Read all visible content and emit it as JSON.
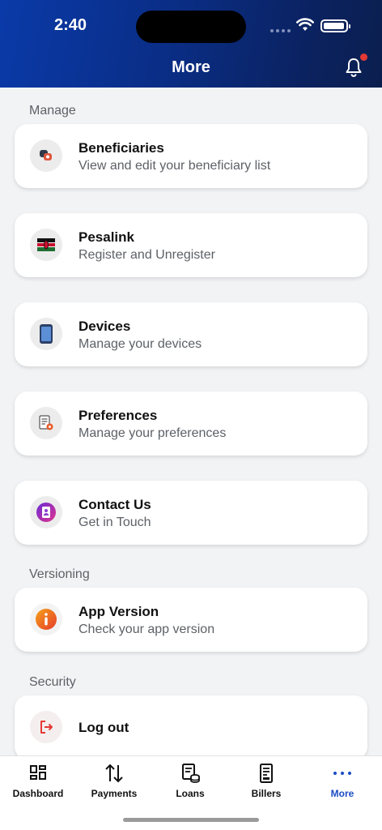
{
  "status_bar": {
    "time": "2:40"
  },
  "header": {
    "title": "More"
  },
  "sections": {
    "manage": "Manage",
    "versioning": "Versioning",
    "security": "Security"
  },
  "items": {
    "beneficiaries": {
      "title": "Beneficiaries",
      "subtitle": "View and edit your beneficiary list",
      "icon": "people-icon"
    },
    "pesalink": {
      "title": "Pesalink",
      "subtitle": "Register and Unregister",
      "icon": "kenya-flag-icon"
    },
    "devices": {
      "title": "Devices",
      "subtitle": "Manage your devices",
      "icon": "phone-icon"
    },
    "preferences": {
      "title": "Preferences",
      "subtitle": "Manage your preferences",
      "icon": "document-gear-icon"
    },
    "contact": {
      "title": "Contact Us",
      "subtitle": "Get in Touch",
      "icon": "contact-book-icon"
    },
    "app_version": {
      "title": "App Version",
      "subtitle": "Check your app version",
      "icon": "info-icon"
    },
    "logout": {
      "title": "Log out",
      "icon": "logout-icon"
    }
  },
  "tabbar": {
    "tabs": [
      {
        "label": "Dashboard",
        "icon": "dashboard-icon"
      },
      {
        "label": "Payments",
        "icon": "transfer-arrows-icon"
      },
      {
        "label": "Loans",
        "icon": "loans-icon"
      },
      {
        "label": "Billers",
        "icon": "bill-icon"
      },
      {
        "label": "More",
        "icon": "more-dots-icon",
        "active": true
      }
    ]
  },
  "colors": {
    "header": "#0a2d85",
    "accent": "#1a4cc4",
    "background": "#f2f3f5"
  }
}
